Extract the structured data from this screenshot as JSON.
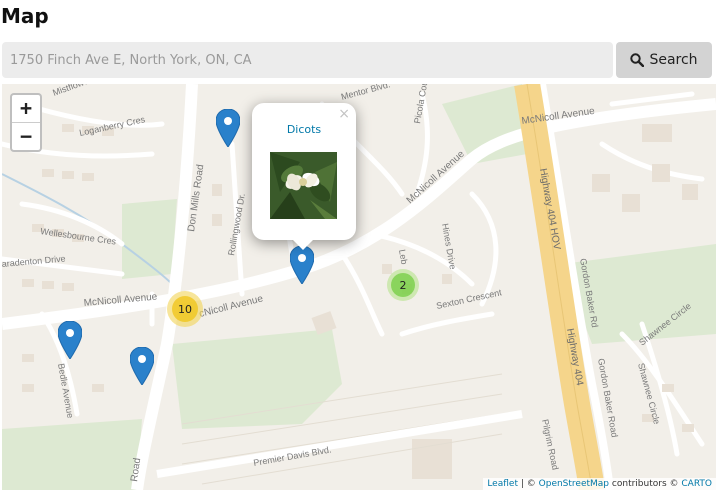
{
  "page": {
    "title": "Map"
  },
  "search": {
    "value": "",
    "placeholder": "1750 Finch Ave E, North York, ON, CA",
    "button_label": "Search"
  },
  "zoom": {
    "in_label": "+",
    "out_label": "−"
  },
  "street_labels": {
    "mistflower": "Mistflower",
    "loganberry": "Loganberry Cres",
    "wellesbourne": "Wellesbourne Cres",
    "paradenton": "aradenton Drive",
    "mcnicoll_west": "McNicoll Avenue",
    "mcnicoll_mid": "cNicoll Avenue",
    "mcnicoll_east": "McNicoll Avenue",
    "don_mills": "Don Mills Road",
    "road_bottom": "Road",
    "mentor": "Mentor Blvd.",
    "picola": "Picola Court",
    "rollingwood": "Rollingwood Dr.",
    "hines": "Hines Drive",
    "lebo": "Leb",
    "sexton": "Sexton Crescent",
    "premier_davis": "Premier Davis Blvd.",
    "bedle": "Bedle Avenue",
    "hwy_404_hov": "Highway 404 HOV",
    "hwy_404": "Highway 404",
    "gordon_baker_1": "Gordon Baker Rd",
    "gordon_baker_2": "Gordon Baker Road",
    "shawnee_circle": "Shawnee Circle",
    "shawnee_crescent": "Shawnee Circle",
    "pilgrim": "Pilgrim Road"
  },
  "clusters": {
    "yellow_count": "10",
    "green_count": "2"
  },
  "popup": {
    "title": "Dicots",
    "close": "×",
    "photo": "white magnolia flower"
  },
  "attribution": {
    "leaflet": "Leaflet",
    "separator": "| ©",
    "osm": "OpenStreetMap",
    "contributors": "contributors ©",
    "carto": "CARTO"
  },
  "colors": {
    "accent": "#0078a8",
    "marker": "#2a81cb",
    "highway": "#f5d58b",
    "park": "#dde9d2"
  }
}
